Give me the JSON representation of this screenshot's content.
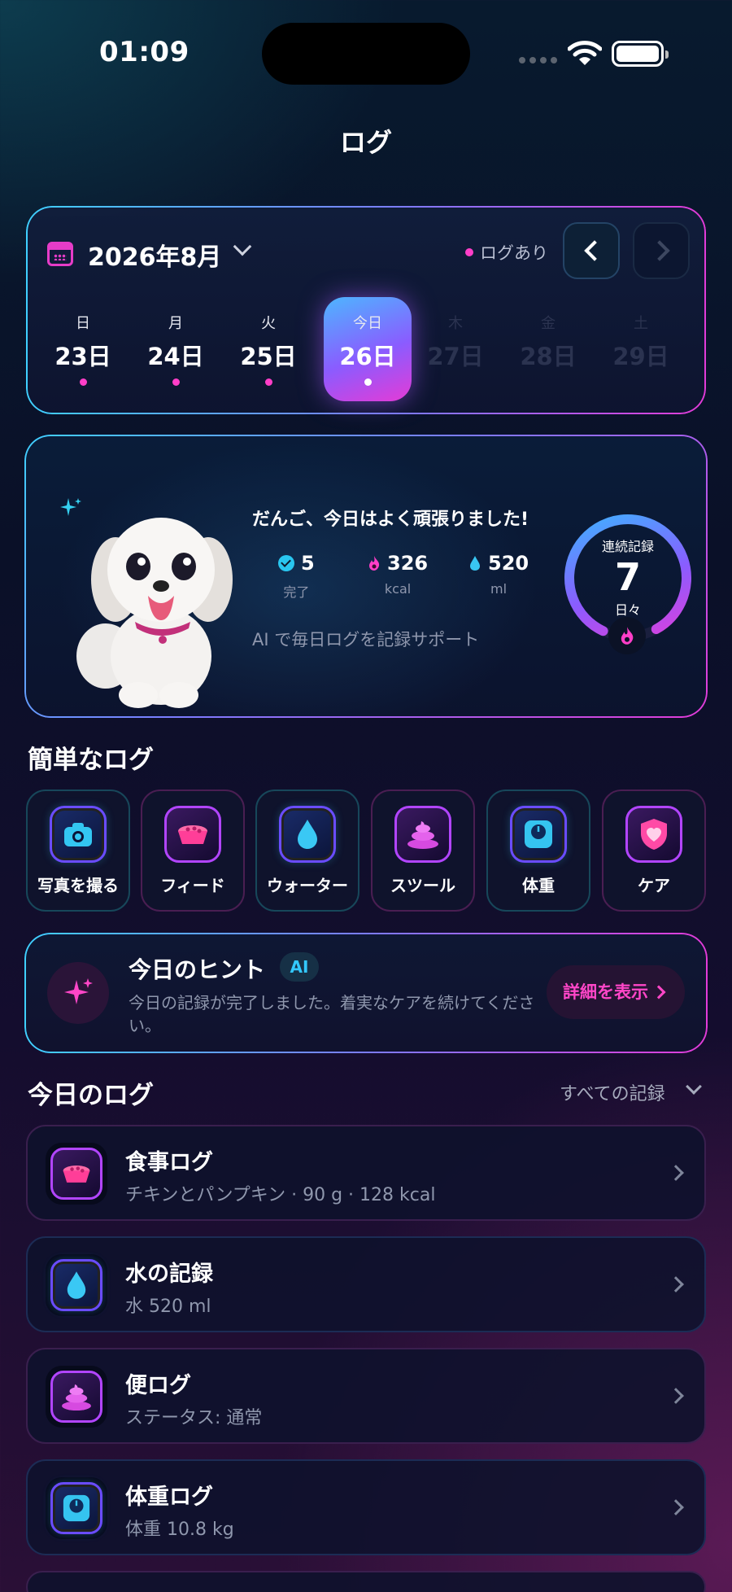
{
  "status_bar": {
    "time": "01:09"
  },
  "page_title": "ログ",
  "calendar": {
    "month": "2026年8月",
    "legend": "ログあり",
    "days": [
      {
        "weekday": "日",
        "date": "23日",
        "state": "logged"
      },
      {
        "weekday": "月",
        "date": "24日",
        "state": "logged"
      },
      {
        "weekday": "火",
        "date": "25日",
        "state": "logged"
      },
      {
        "weekday": "今日",
        "date": "26日",
        "state": "today"
      },
      {
        "weekday": "木",
        "date": "27日",
        "state": "future"
      },
      {
        "weekday": "金",
        "date": "28日",
        "state": "future"
      },
      {
        "weekday": "土",
        "date": "29日",
        "state": "future"
      }
    ]
  },
  "summary": {
    "greeting": "だんご、今日はよく頑張りました!",
    "stats": [
      {
        "value": "5",
        "label": "完了",
        "icon": "check-icon"
      },
      {
        "value": "326",
        "label": "kcal",
        "icon": "flame-icon"
      },
      {
        "value": "520",
        "label": "ml",
        "icon": "water-drop-icon"
      }
    ],
    "ai_note": "AI で毎日ログを記録サポート",
    "streak": {
      "label": "連続記録",
      "value": "7",
      "unit": "日々",
      "progress": 0.85
    }
  },
  "quick_log": {
    "title": "簡単なログ",
    "items": [
      {
        "label": "写真を撮る",
        "icon": "camera-icon"
      },
      {
        "label": "フィード",
        "icon": "food-bowl-icon"
      },
      {
        "label": "ウォーター",
        "icon": "water-drop-icon"
      },
      {
        "label": "スツール",
        "icon": "stool-icon"
      },
      {
        "label": "体重",
        "icon": "scale-icon"
      },
      {
        "label": "ケア",
        "icon": "heart-shield-icon"
      }
    ]
  },
  "hint": {
    "title": "今日のヒント",
    "badge": "AI",
    "body": "今日の記録が完了しました。着実なケアを続けてください。",
    "button": "詳細を表示"
  },
  "today_log": {
    "title": "今日のログ",
    "filter": "すべての記録",
    "items": [
      {
        "title": "食事ログ",
        "subtitle": "チキンとパンプキン · 90 g · 128 kcal",
        "icon": "food-bowl-icon"
      },
      {
        "title": "水の記録",
        "subtitle": "水 520 ml",
        "icon": "water-drop-icon"
      },
      {
        "title": "便ログ",
        "subtitle": "ステータス: 通常",
        "icon": "stool-icon"
      },
      {
        "title": "体重ログ",
        "subtitle": "体重 10.8 kg",
        "icon": "scale-icon"
      }
    ]
  },
  "colors": {
    "accent_pink": "#ff3ec8",
    "accent_cyan": "#3fd0ff",
    "accent_violet": "#7b7cff"
  }
}
